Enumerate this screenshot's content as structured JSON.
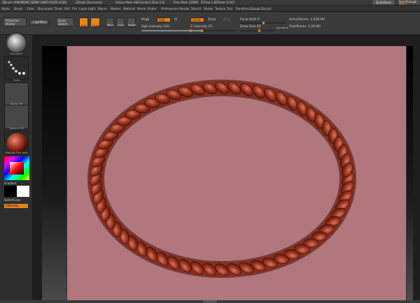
{
  "titlebar": {
    "app": "ZBrush 4R8",
    "build": "[MDMC-BZNP-QWEY-ROZE-HFJE]",
    "document": "ZBrush Document",
    "active_mem": "Active Mem 466",
    "scratch_disk": "Scratch Disk 132",
    "free_mem": "Free Mem 22995",
    "ztime": "ZTime 1.82",
    "timer": "Timer 0.167",
    "quicksave": "QuickSave",
    "see_through": "See-through"
  },
  "menu": [
    "Alpha",
    "Brush",
    "Color",
    "Document",
    "Draw",
    "Edit",
    "File",
    "Layer",
    "Light",
    "Macro",
    "Marker",
    "Material",
    "Movie",
    "Picker",
    "Preferences",
    "Render",
    "Stencil",
    "Stroke",
    "Texture",
    "Tool",
    "Transform",
    "Zplugin",
    "Zscript"
  ],
  "shelf": {
    "projection_master": "Projection Master",
    "lightbox": "LightBox",
    "quick_sketch": "Quick Sketch",
    "edit": "Edit",
    "draw": "Draw",
    "move": "Move",
    "scale": "Scale",
    "rotate": "Rotate",
    "mrgb": "Mrgb",
    "rgb": "Rgb",
    "m": "M",
    "rgb_intensity": "Rgb Intensity 100",
    "zadd": "Zadd",
    "zsub": "Zsub",
    "zcut": "Zcut",
    "z_intensity": "Z Intensity 25",
    "focal_shift": "Focal Shift 0",
    "draw_size": "Draw Size 64",
    "dynamic": "Dynamic",
    "active_points": "ActivePoints: 1.026 Mil",
    "total_points": "TotalPoints: 1.26 Mil",
    "rgb_intensity_value": 100,
    "z_intensity_value": 25,
    "focal_shift_value": 0,
    "draw_size_value": 64
  },
  "lefttray": {
    "brush": "Standard",
    "stroke": "Dots",
    "alpha": "Alpha Off",
    "texture": "Texture Off",
    "material": "MatCap Red Wax",
    "gradient": "Gradient",
    "switch_color": "SwitchColor",
    "alternate": "Alternate"
  },
  "colors": {
    "accent": "#e8831a",
    "selection": "#b0777d",
    "rope_dark": "#5a1a10",
    "rope_mid": "#9a3a28",
    "rope_light": "#d0735a"
  }
}
